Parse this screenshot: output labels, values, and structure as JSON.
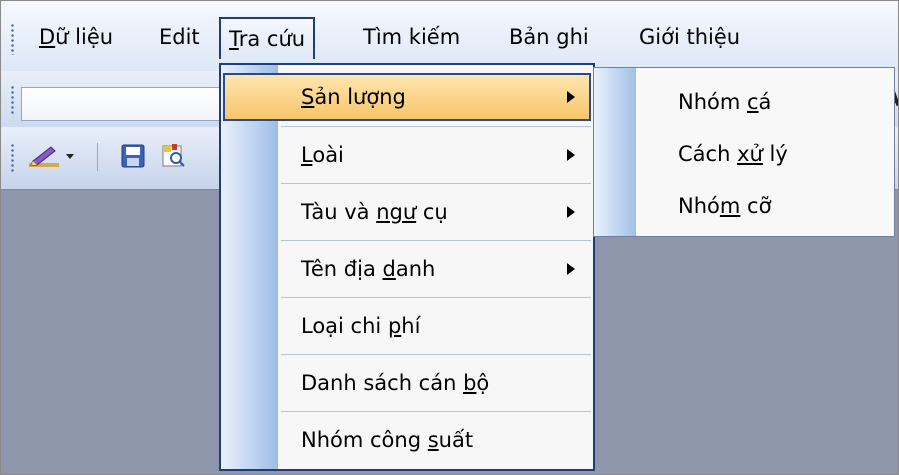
{
  "menu": {
    "items": [
      {
        "pre": "",
        "u": "D",
        "post": "ữ liệu"
      },
      {
        "pre": "Edit",
        "u": "",
        "post": ""
      },
      {
        "pre": "",
        "u": "T",
        "post": "ra cứu"
      },
      {
        "pre": "Tìm kiếm",
        "u": "",
        "post": ""
      },
      {
        "pre": "Bản ghi",
        "u": "",
        "post": ""
      },
      {
        "pre": "Giới thiệu",
        "u": "",
        "post": ""
      }
    ]
  },
  "dropdown": {
    "items": [
      {
        "pre": "",
        "u": "S",
        "post": "ản lượng",
        "submenu": true
      },
      {
        "pre": "",
        "u": "L",
        "post": "oài",
        "submenu": true
      },
      {
        "pre": "Tàu và ",
        "u": "ngư",
        "post": " cụ",
        "submenu": true
      },
      {
        "pre": "Tên địa ",
        "u": "d",
        "post": "anh",
        "submenu": true
      },
      {
        "pre": "Loại chi ",
        "u": "p",
        "post": "hí",
        "submenu": false
      },
      {
        "pre": "Danh sách cán ",
        "u": "b",
        "post": "ộ",
        "submenu": false
      },
      {
        "pre": "Nhóm công ",
        "u": "s",
        "post": "uất",
        "submenu": false
      }
    ]
  },
  "submenu": {
    "items": [
      {
        "pre": "Nhóm ",
        "u": "c",
        "post": "á"
      },
      {
        "pre": "Cách ",
        "u": "xử",
        "post": " lý"
      },
      {
        "pre": "Nhó",
        "u": "m",
        "post": " cỡ"
      }
    ]
  },
  "icons": [
    "grip-icon",
    "edit-pencil-icon",
    "dropdown-arrow-icon",
    "save-icon",
    "preview-icon"
  ],
  "colors": {
    "menu_border": "#1f3d7a",
    "highlight_top": "#fde6b0",
    "highlight_bottom": "#f8c56a",
    "workspace": "#8e96ab",
    "menu_strip": "#9ebde6"
  }
}
